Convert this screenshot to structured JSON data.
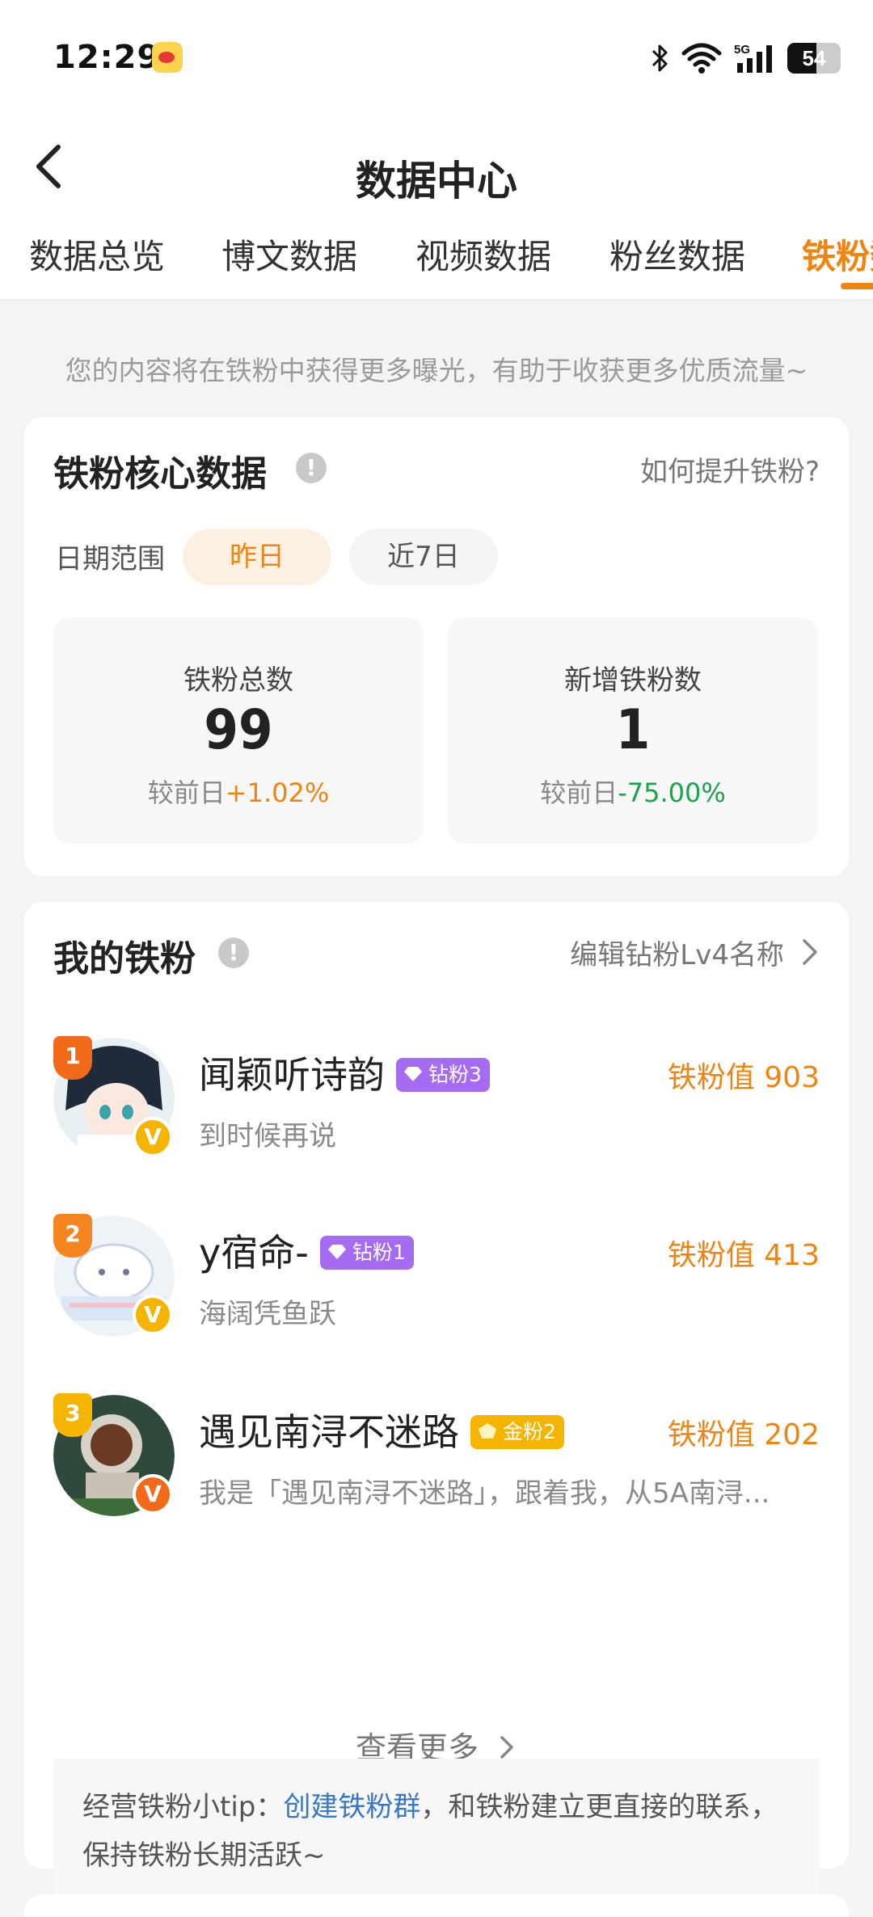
{
  "status_bar": {
    "time": "12:29",
    "battery_level": "54",
    "network": "5G",
    "icons": [
      "weibo-notification-icon",
      "bluetooth-icon",
      "wifi-icon",
      "signal-icon",
      "battery-icon"
    ]
  },
  "nav": {
    "title": "数据中心",
    "back_icon": "chevron-left-icon"
  },
  "tabs": [
    {
      "label": "数据总览",
      "active": false
    },
    {
      "label": "博文数据",
      "active": false
    },
    {
      "label": "视频数据",
      "active": false
    },
    {
      "label": "粉丝数据",
      "active": false
    },
    {
      "label": "铁粉数据",
      "active": true
    }
  ],
  "hint": "您的内容将在铁粉中获得更多曝光，有助于收获更多优质流量~",
  "core": {
    "title": "铁粉核心数据",
    "info_icon": "!",
    "help_link": "如何提升铁粉?",
    "date_label": "日期范围",
    "range_options": [
      "昨日",
      "近7日"
    ],
    "selected_range": "昨日",
    "stats": [
      {
        "label": "铁粉总数",
        "value": "99",
        "compare_label": "较前日",
        "change": "+1.02%",
        "trend": "up"
      },
      {
        "label": "新增铁粉数",
        "value": "1",
        "compare_label": "较前日",
        "change": "-75.00%",
        "trend": "down"
      }
    ]
  },
  "my_fans": {
    "title": "我的铁粉",
    "info_icon": "!",
    "edit_link": "编辑钻粉Lv4名称",
    "edit_icon": "chevron-right-icon",
    "score_prefix": "铁粉值",
    "items": [
      {
        "rank": "1",
        "name": "闻颖听诗韵",
        "badge": "钻粉3",
        "badge_type": "diamond",
        "desc": "到时候再说",
        "score": "铁粉值 903",
        "verify": "V",
        "verify_color": "#f5b400",
        "rank_color": "#f06a1a"
      },
      {
        "rank": "2",
        "name": "y宿命-",
        "badge": "钻粉1",
        "badge_type": "diamond",
        "desc": "海阔凭鱼跃",
        "score": "铁粉值 413",
        "verify": "V",
        "verify_color": "#f5b400",
        "rank_color": "#f5861f"
      },
      {
        "rank": "3",
        "name": "遇见南浔不迷路",
        "badge": "金粉2",
        "badge_type": "gold",
        "desc": "我是「遇见南浔不迷路」，跟着我，从5A南浔...",
        "score": "铁粉值 202",
        "verify": "V",
        "verify_color": "#f06a1a",
        "rank_color": "#f5b400"
      }
    ],
    "more_label": "查看更多",
    "more_icon": "chevron-right-icon",
    "tip": {
      "prefix": "经营铁粉小tip：",
      "link": "创建铁粉群",
      "suffix": "，和铁粉建立更直接的联系，保持铁粉长期活跃~"
    }
  },
  "colors": {
    "accent": "#f08410",
    "up": "#f08410",
    "down": "#19a34a",
    "diamond_badge": "#a56bf0",
    "gold_badge": "#f5b400",
    "link": "#3a77c2"
  }
}
